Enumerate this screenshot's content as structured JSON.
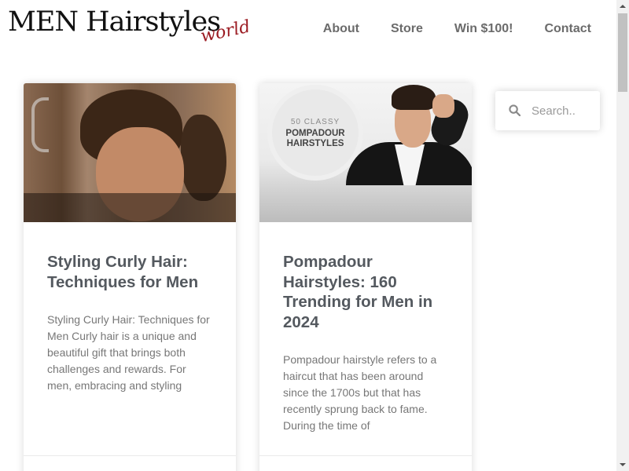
{
  "header": {
    "logo_main": "MEN Hairstyles",
    "logo_script": "world",
    "nav": [
      "About",
      "Store",
      "Win $100!",
      "Contact"
    ]
  },
  "posts": [
    {
      "title": "Styling Curly Hair: Techniques for Men",
      "excerpt": "Styling Curly Hair: Techniques for Men Curly hair is a unique and beautiful gift that brings both challenges and rewards. For men, embracing and styling",
      "image_icon": "curly-hair-man-photo"
    },
    {
      "title": "Pompadour Hairstyles: 160 Trending for Men in 2024",
      "excerpt": "Pompadour hairstyle refers to a haircut that has been around since the 1700s but that has recently sprung back to fame. During the time of",
      "image_icon": "pompadour-man-photo",
      "image_badge_line1": "50 CLASSY",
      "image_badge_line2": "POMPADOUR HAIRSTYLES"
    }
  ],
  "search": {
    "placeholder": "Search.."
  },
  "colors": {
    "logo_accent": "#9b1b22",
    "nav_text": "#6b6b6b",
    "title_text": "#54595f",
    "excerpt_text": "#777777"
  }
}
